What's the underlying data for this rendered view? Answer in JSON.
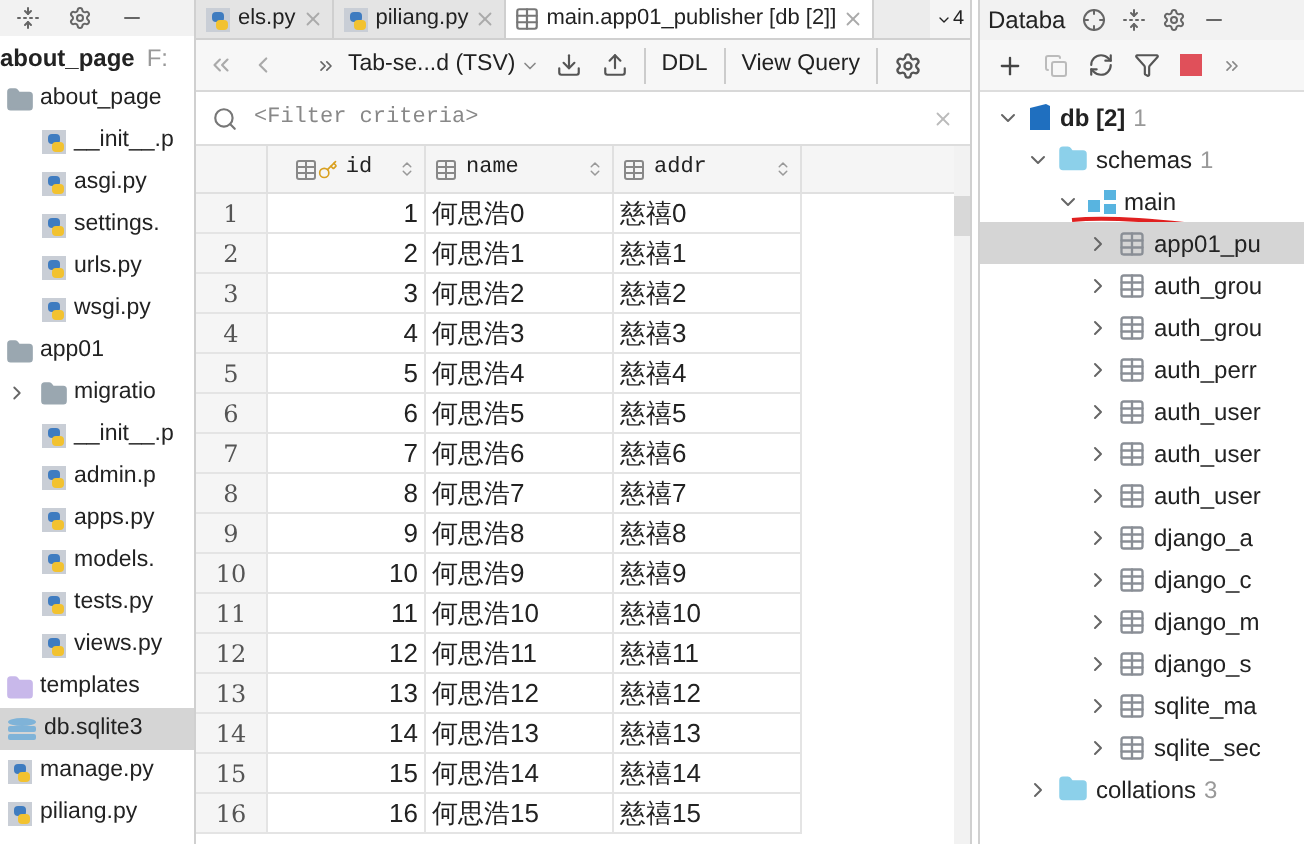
{
  "project": {
    "title": "about_page",
    "path": "F:",
    "items": [
      {
        "label": "about_page",
        "kind": "folder",
        "selected": false,
        "children": [
          {
            "label": "__init__.p",
            "kind": "python",
            "selected": false
          },
          {
            "label": "asgi.py",
            "kind": "python",
            "selected": false
          },
          {
            "label": "settings.",
            "kind": "python",
            "selected": false
          },
          {
            "label": "urls.py",
            "kind": "python",
            "selected": false
          },
          {
            "label": "wsgi.py",
            "kind": "python",
            "selected": false
          }
        ]
      },
      {
        "label": "app01",
        "kind": "folder",
        "selected": false,
        "children": [
          {
            "label": "migratio",
            "kind": "folder",
            "selected": false,
            "expanded": false
          },
          {
            "label": "__init__.p",
            "kind": "python",
            "selected": false
          },
          {
            "label": "admin.p",
            "kind": "python",
            "selected": false
          },
          {
            "label": "apps.py",
            "kind": "python",
            "selected": false
          },
          {
            "label": "models.",
            "kind": "python",
            "selected": false
          },
          {
            "label": "tests.py",
            "kind": "python",
            "selected": false
          },
          {
            "label": "views.py",
            "kind": "python",
            "selected": false
          }
        ]
      },
      {
        "label": "templates",
        "kind": "templates",
        "selected": false
      },
      {
        "label": "db.sqlite3",
        "kind": "database",
        "selected": true
      },
      {
        "label": "manage.py",
        "kind": "python",
        "selected": false
      },
      {
        "label": "piliang.py",
        "kind": "python",
        "selected": false
      }
    ]
  },
  "tabs": [
    {
      "label": "els.py",
      "kind": "python",
      "selected": false
    },
    {
      "label": "piliang.py",
      "kind": "python",
      "selected": false
    },
    {
      "label": "main.app01_publisher [db [2]]",
      "kind": "table",
      "selected": true
    }
  ],
  "tab_overflow": "4",
  "toolbar": {
    "format": "Tab-se...d (TSV)",
    "ddl": "DDL",
    "view_query": "View Query"
  },
  "filter": {
    "placeholder": "<Filter criteria>"
  },
  "table": {
    "columns": [
      {
        "label": "id",
        "kind": "key"
      },
      {
        "label": "name",
        "kind": "column"
      },
      {
        "label": "addr",
        "kind": "column"
      }
    ],
    "rows": [
      {
        "n": "1",
        "cells": [
          "1",
          "何思浩0",
          "慈禧0"
        ]
      },
      {
        "n": "2",
        "cells": [
          "2",
          "何思浩1",
          "慈禧1"
        ]
      },
      {
        "n": "3",
        "cells": [
          "3",
          "何思浩2",
          "慈禧2"
        ]
      },
      {
        "n": "4",
        "cells": [
          "4",
          "何思浩3",
          "慈禧3"
        ]
      },
      {
        "n": "5",
        "cells": [
          "5",
          "何思浩4",
          "慈禧4"
        ]
      },
      {
        "n": "6",
        "cells": [
          "6",
          "何思浩5",
          "慈禧5"
        ]
      },
      {
        "n": "7",
        "cells": [
          "7",
          "何思浩6",
          "慈禧6"
        ]
      },
      {
        "n": "8",
        "cells": [
          "8",
          "何思浩7",
          "慈禧7"
        ]
      },
      {
        "n": "9",
        "cells": [
          "9",
          "何思浩8",
          "慈禧8"
        ]
      },
      {
        "n": "10",
        "cells": [
          "10",
          "何思浩9",
          "慈禧9"
        ]
      },
      {
        "n": "11",
        "cells": [
          "11",
          "何思浩10",
          "慈禧10"
        ]
      },
      {
        "n": "12",
        "cells": [
          "12",
          "何思浩11",
          "慈禧11"
        ]
      },
      {
        "n": "13",
        "cells": [
          "13",
          "何思浩12",
          "慈禧12"
        ]
      },
      {
        "n": "14",
        "cells": [
          "14",
          "何思浩13",
          "慈禧13"
        ]
      },
      {
        "n": "15",
        "cells": [
          "15",
          "何思浩14",
          "慈禧14"
        ]
      },
      {
        "n": "16",
        "cells": [
          "16",
          "何思浩15",
          "慈禧15"
        ]
      }
    ]
  },
  "database": {
    "title": "Databa",
    "tree": [
      {
        "label": "db [2]",
        "count": "1",
        "kind": "db",
        "expanded": true,
        "selected": false,
        "children": [
          {
            "label": "schemas",
            "count": "1",
            "kind": "folder",
            "expanded": true,
            "selected": false,
            "children": [
              {
                "label": "main",
                "kind": "schema",
                "expanded": true,
                "selected": false,
                "underlined": true,
                "children": [
                  {
                    "label": "app01_pu",
                    "kind": "table",
                    "expanded": false,
                    "selected": true
                  },
                  {
                    "label": "auth_grou",
                    "kind": "table",
                    "expanded": false,
                    "selected": false
                  },
                  {
                    "label": "auth_grou",
                    "kind": "table",
                    "expanded": false,
                    "selected": false
                  },
                  {
                    "label": "auth_perr",
                    "kind": "table",
                    "expanded": false,
                    "selected": false
                  },
                  {
                    "label": "auth_user",
                    "kind": "table",
                    "expanded": false,
                    "selected": false
                  },
                  {
                    "label": "auth_user",
                    "kind": "table",
                    "expanded": false,
                    "selected": false
                  },
                  {
                    "label": "auth_user",
                    "kind": "table",
                    "expanded": false,
                    "selected": false
                  },
                  {
                    "label": "django_a",
                    "kind": "table",
                    "expanded": false,
                    "selected": false
                  },
                  {
                    "label": "django_c",
                    "kind": "table",
                    "expanded": false,
                    "selected": false
                  },
                  {
                    "label": "django_m",
                    "kind": "table",
                    "expanded": false,
                    "selected": false
                  },
                  {
                    "label": "django_s",
                    "kind": "table",
                    "expanded": false,
                    "selected": false
                  },
                  {
                    "label": "sqlite_ma",
                    "kind": "table",
                    "expanded": false,
                    "selected": false
                  },
                  {
                    "label": "sqlite_sec",
                    "kind": "table",
                    "expanded": false,
                    "selected": false
                  }
                ]
              }
            ]
          },
          {
            "label": "collations",
            "count": "3",
            "kind": "folder",
            "expanded": false,
            "selected": false
          }
        ]
      }
    ]
  }
}
